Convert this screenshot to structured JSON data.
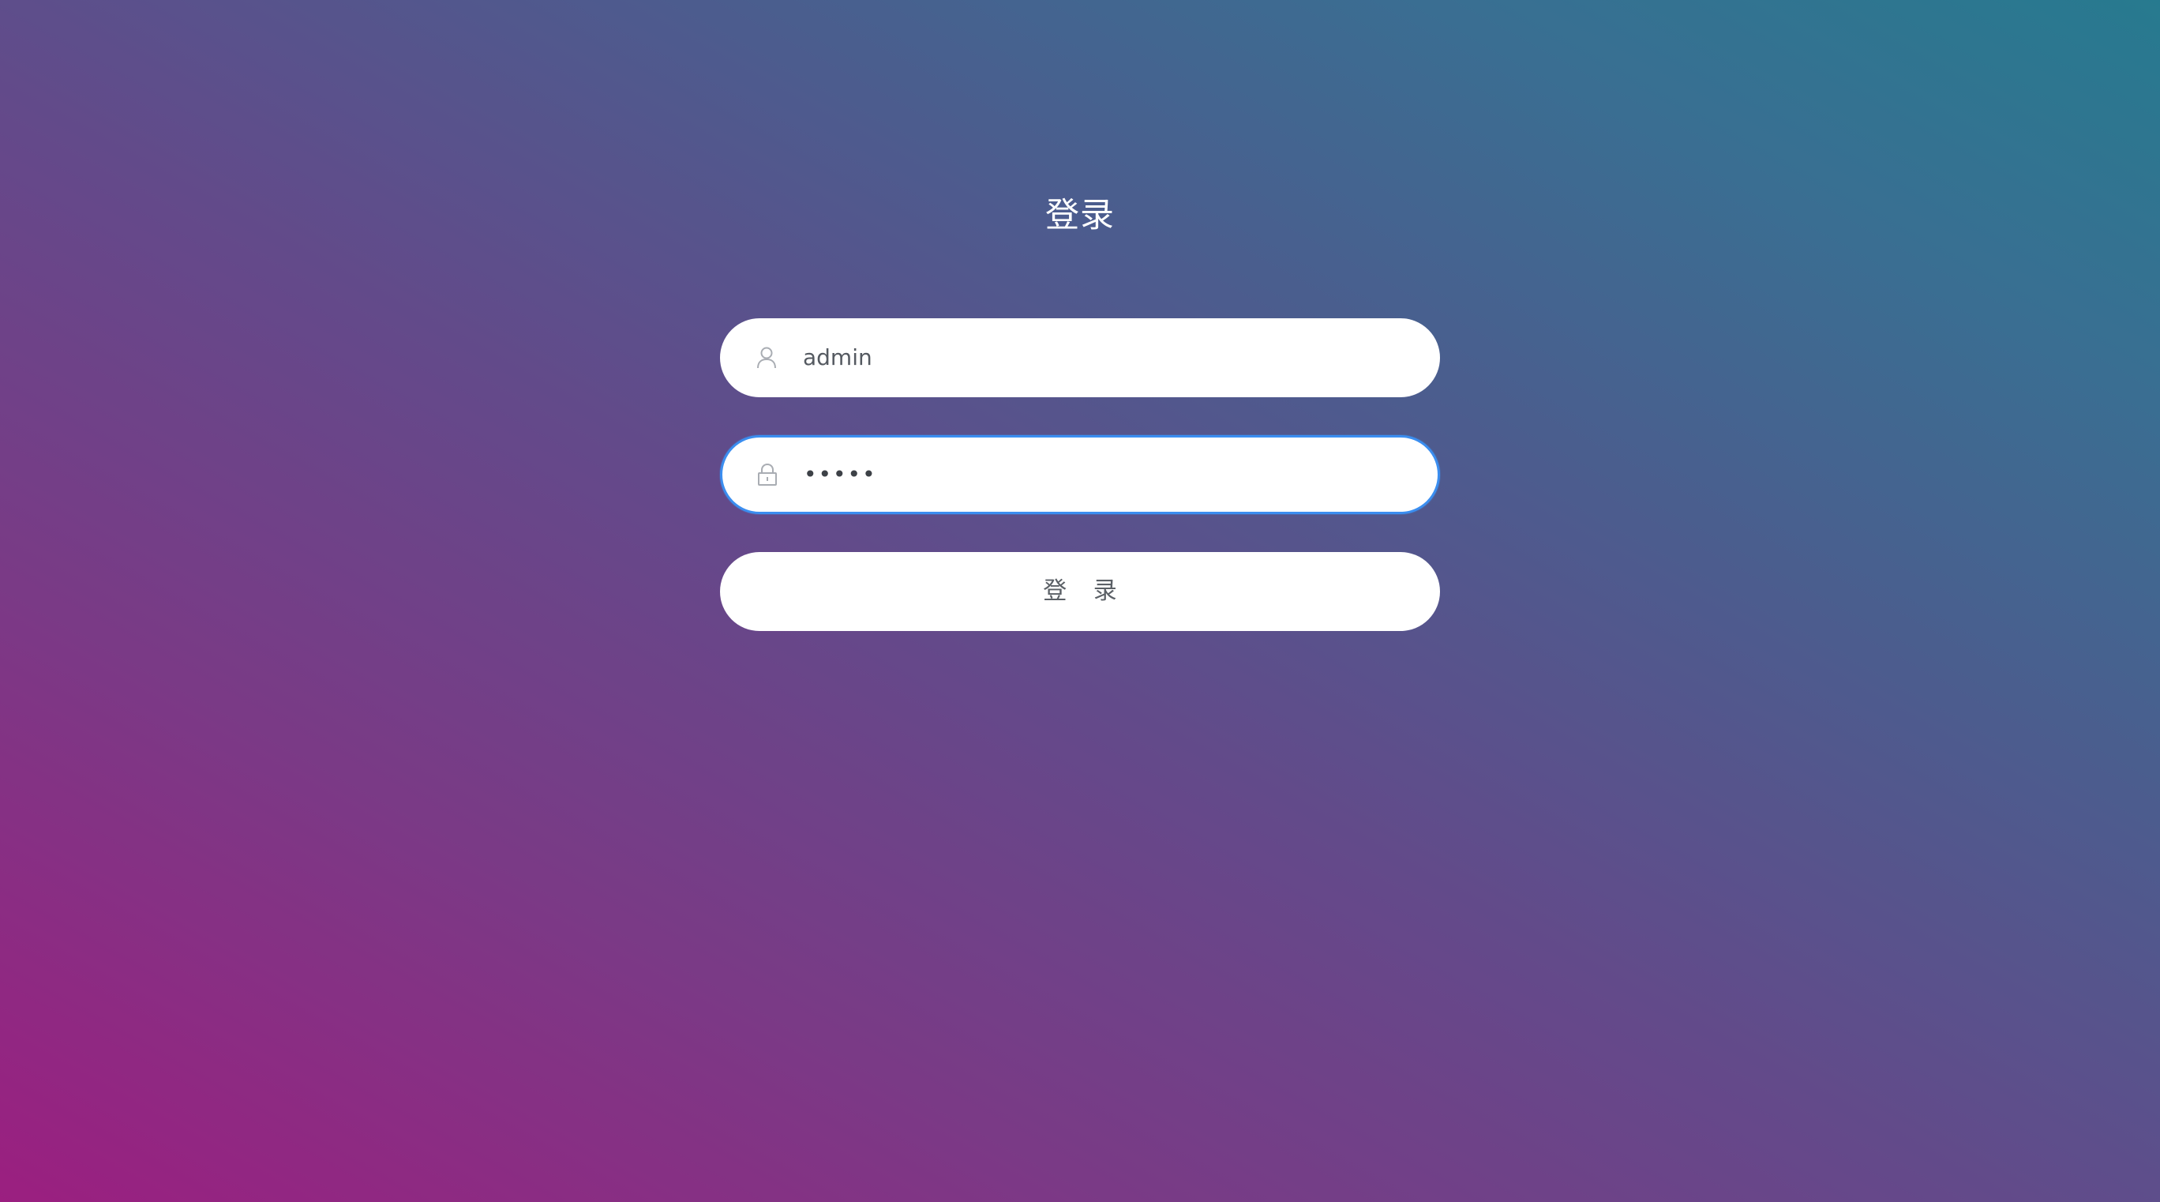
{
  "page": {
    "title": "登录"
  },
  "form": {
    "username": {
      "value": "admin",
      "icon": "user-icon"
    },
    "password": {
      "value": "•••••",
      "icon": "lock-icon",
      "focused": true
    },
    "submit_label": "登 录"
  },
  "colors": {
    "background_gradient_start": "#9b1f80",
    "background_gradient_end": "#277a8f",
    "focus_border": "#3b8ef0",
    "field_background": "#ffffff"
  }
}
